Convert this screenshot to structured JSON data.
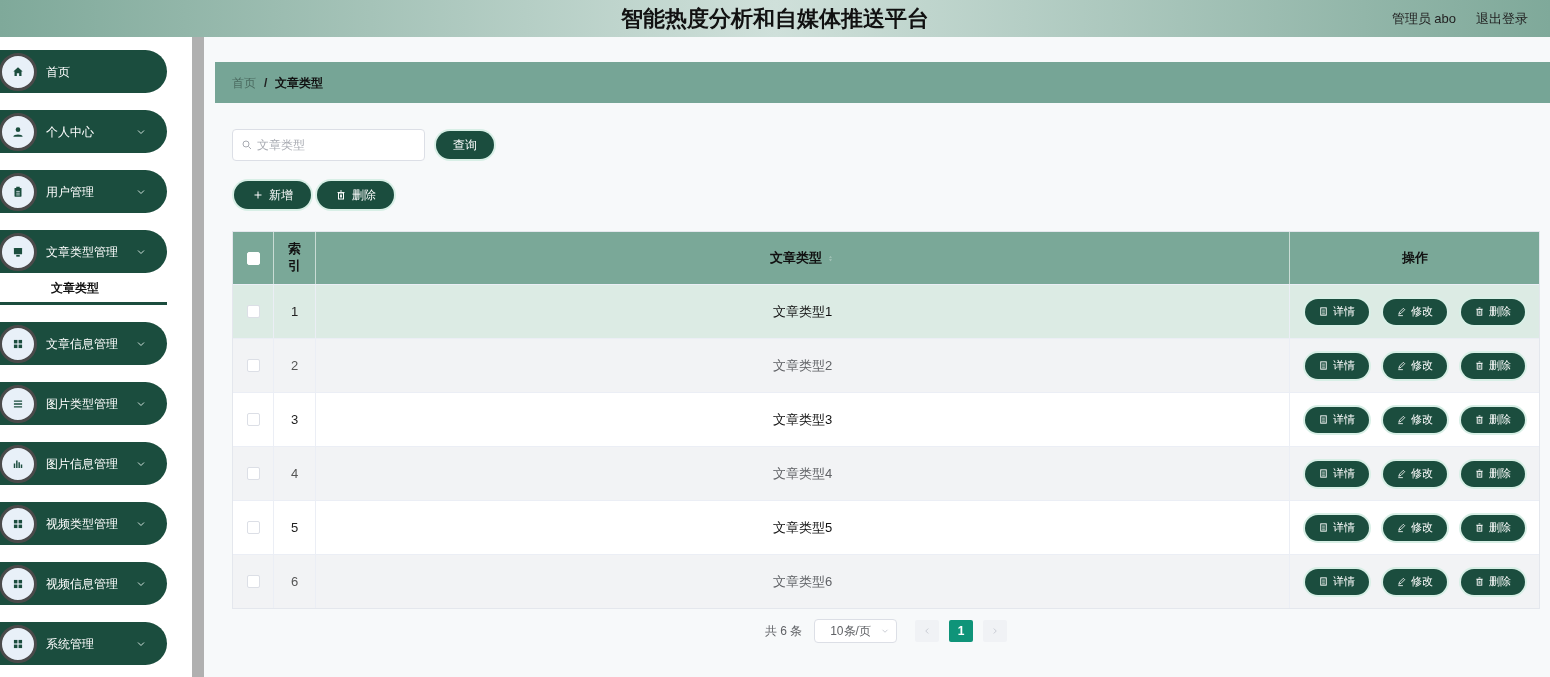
{
  "header": {
    "title": "智能热度分析和自媒体推送平台",
    "user": "管理员 abo",
    "logout": "退出登录"
  },
  "sidebar": {
    "items": [
      {
        "label": "首页",
        "has_arrow": false
      },
      {
        "label": "个人中心",
        "has_arrow": true
      },
      {
        "label": "用户管理",
        "has_arrow": true
      },
      {
        "label": "文章类型管理",
        "has_arrow": true,
        "children": [
          {
            "label": "文章类型",
            "selected": true
          }
        ]
      },
      {
        "label": "文章信息管理",
        "has_arrow": true
      },
      {
        "label": "图片类型管理",
        "has_arrow": true
      },
      {
        "label": "图片信息管理",
        "has_arrow": true
      },
      {
        "label": "视频类型管理",
        "has_arrow": true
      },
      {
        "label": "视频信息管理",
        "has_arrow": true
      },
      {
        "label": "系统管理",
        "has_arrow": true
      }
    ]
  },
  "breadcrumb": [
    "首页",
    "/",
    "文章类型"
  ],
  "search": {
    "placeholder": "文章类型",
    "button": "查询"
  },
  "actions": [
    {
      "kind": "add",
      "label": "新增"
    },
    {
      "kind": "delete",
      "label": "删除"
    }
  ],
  "table": {
    "columns": [
      "索引",
      "文章类型",
      "操作"
    ],
    "select_all_checked": false,
    "rows": [
      {
        "index": "1",
        "name": "文章类型1",
        "checked": false,
        "hovered": true,
        "actions": [
          {
            "kind": "detail",
            "label": "详情"
          },
          {
            "kind": "edit",
            "label": "修改"
          },
          {
            "kind": "delete",
            "label": "删除"
          }
        ]
      },
      {
        "index": "2",
        "name": "文章类型2",
        "checked": false,
        "hovered": false,
        "actions": [
          {
            "kind": "detail",
            "label": "详情"
          },
          {
            "kind": "edit",
            "label": "修改"
          },
          {
            "kind": "delete",
            "label": "删除"
          }
        ]
      },
      {
        "index": "3",
        "name": "文章类型3",
        "checked": false,
        "hovered": false,
        "actions": [
          {
            "kind": "detail",
            "label": "详情"
          },
          {
            "kind": "edit",
            "label": "修改"
          },
          {
            "kind": "delete",
            "label": "删除"
          }
        ]
      },
      {
        "index": "4",
        "name": "文章类型4",
        "checked": false,
        "hovered": false,
        "actions": [
          {
            "kind": "detail",
            "label": "详情"
          },
          {
            "kind": "edit",
            "label": "修改"
          },
          {
            "kind": "delete",
            "label": "删除"
          }
        ]
      },
      {
        "index": "5",
        "name": "文章类型5",
        "checked": false,
        "hovered": false,
        "actions": [
          {
            "kind": "detail",
            "label": "详情"
          },
          {
            "kind": "edit",
            "label": "修改"
          },
          {
            "kind": "delete",
            "label": "删除"
          }
        ]
      },
      {
        "index": "6",
        "name": "文章类型6",
        "checked": false,
        "hovered": false,
        "actions": [
          {
            "kind": "detail",
            "label": "详情"
          },
          {
            "kind": "edit",
            "label": "修改"
          },
          {
            "kind": "delete",
            "label": "删除"
          }
        ]
      }
    ]
  },
  "pagination": {
    "total": "共 6 条",
    "page_size": "10条/页",
    "pages": [
      {
        "label": "1",
        "selected": true
      }
    ]
  }
}
